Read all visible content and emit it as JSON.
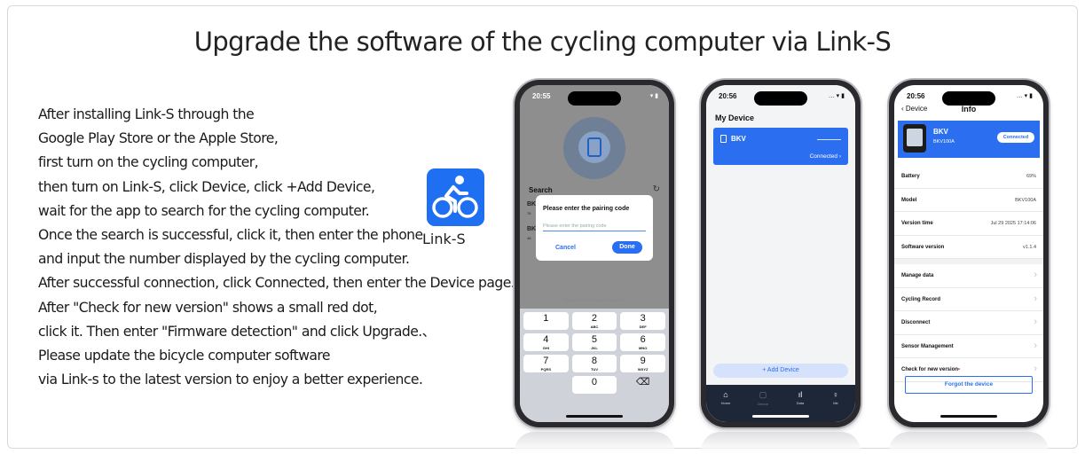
{
  "title": "Upgrade the software of the cycling computer via Link-S",
  "instructions": [
    "After installing Link-S through the",
    "Google Play Store or the Apple Store,",
    "first turn on the cycling computer,",
    "then turn on Link-S, click Device, click +Add Device,",
    " wait for the app to search for the cycling computer.",
    "Once the search is successful, click it, then enter the phone",
    "and input the number displayed by the cycling computer.",
    "After successful connection, click Connected, then enter the Device page.",
    "After \"Check for new version\" shows a small red dot,",
    "click it. Then enter \"Firmware detection\" and click Upgrade.、",
    "Please update the bicycle computer software",
    "via Link-s to the latest version to enjoy a better experience."
  ],
  "app": {
    "label": "Link-S",
    "icon": "bicycle-rider-icon",
    "color": "#1f6ff2"
  },
  "phone1": {
    "time": "20:55",
    "search_label": "Search",
    "list_items": [
      "BK",
      "76",
      "BK",
      "48"
    ],
    "dialog": {
      "title": "Please enter the pairing code",
      "placeholder": "Please enter the pairing code",
      "cancel": "Cancel",
      "done": "Done"
    },
    "keyboard_hint": "Please enter the pairing code",
    "keys": [
      {
        "main": "1",
        "sub": ""
      },
      {
        "main": "2",
        "sub": "ABC"
      },
      {
        "main": "3",
        "sub": "DEF"
      },
      {
        "main": "4",
        "sub": "GHI"
      },
      {
        "main": "5",
        "sub": "JKL"
      },
      {
        "main": "6",
        "sub": "MNO"
      },
      {
        "main": "7",
        "sub": "PQRS"
      },
      {
        "main": "8",
        "sub": "TUV"
      },
      {
        "main": "9",
        "sub": "WXYZ"
      },
      {
        "main": "",
        "sub": ""
      },
      {
        "main": "0",
        "sub": ""
      },
      {
        "main": "⌫",
        "sub": ""
      }
    ]
  },
  "phone2": {
    "time": "20:56",
    "title": "My Device",
    "device_name": "BKV",
    "connected": "Connected ›",
    "add_device": "+ Add Device",
    "tabs": [
      "Home",
      "Device",
      "Data",
      "Me"
    ]
  },
  "phone3": {
    "time": "20:56",
    "back": "‹ Device",
    "title": "Info",
    "device_name": "BKV",
    "device_model": "BKV100A",
    "badge": "Connected",
    "info_rows": [
      {
        "label": "Battery",
        "value": "69%"
      },
      {
        "label": "Model",
        "value": "BKV100A"
      },
      {
        "label": "Version time",
        "value": "Jul 29 2025 17:14:06"
      },
      {
        "label": "Software version",
        "value": "v1.1.4"
      }
    ],
    "menu_rows": [
      "Manage data",
      "Cycling Record",
      "Disconnect",
      "Sensor Management",
      "Check for new version"
    ],
    "forgot": "Forgot the device"
  }
}
